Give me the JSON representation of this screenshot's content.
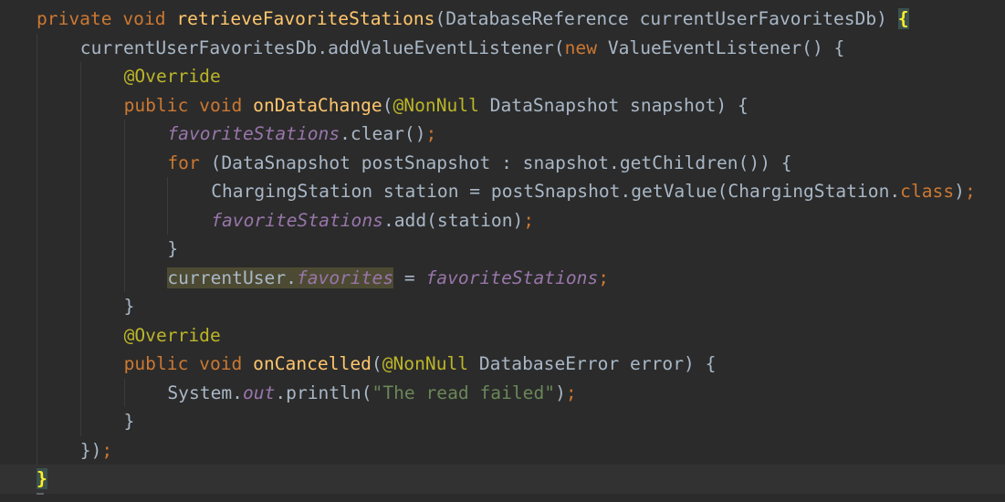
{
  "editor": {
    "language": "Java",
    "theme_colors": {
      "background": "#2b2b2b",
      "current_line": "#323232",
      "keyword": "#cc7832",
      "method": "#ffc66d",
      "annotation": "#bbb529",
      "field": "#9876aa",
      "string": "#6a8759",
      "default": "#a9b7c6"
    },
    "lines": [
      {
        "indent": 0,
        "tokens": [
          {
            "t": "private",
            "c": "kw"
          },
          {
            "t": " "
          },
          {
            "t": "void",
            "c": "kw"
          },
          {
            "t": " "
          },
          {
            "t": "retrieveFavoriteStations",
            "c": "fn"
          },
          {
            "t": "(DatabaseReference currentUserFavoritesDb) "
          },
          {
            "t": "{",
            "c": "brace-match"
          }
        ]
      },
      {
        "indent": 1,
        "tokens": [
          {
            "t": "currentUserFavoritesDb.addValueEventListener("
          },
          {
            "t": "new",
            "c": "kw"
          },
          {
            "t": " ValueEventListener() {"
          }
        ]
      },
      {
        "indent": 2,
        "tokens": [
          {
            "t": "@Override",
            "c": "ann"
          }
        ]
      },
      {
        "indent": 2,
        "tokens": [
          {
            "t": "public",
            "c": "kw"
          },
          {
            "t": " "
          },
          {
            "t": "void",
            "c": "kw"
          },
          {
            "t": " "
          },
          {
            "t": "onDataChange",
            "c": "fn"
          },
          {
            "t": "("
          },
          {
            "t": "@NonNull",
            "c": "ann"
          },
          {
            "t": " DataSnapshot snapshot) {"
          }
        ]
      },
      {
        "indent": 3,
        "tokens": [
          {
            "t": "favoriteStations",
            "c": "fld"
          },
          {
            "t": ".clear()"
          },
          {
            "t": ";",
            "c": "pun"
          }
        ]
      },
      {
        "indent": 3,
        "tokens": [
          {
            "t": "for",
            "c": "kw"
          },
          {
            "t": " (DataSnapshot postSnapshot : snapshot.getChildren()) {"
          }
        ]
      },
      {
        "indent": 4,
        "tokens": [
          {
            "t": "ChargingStation station = postSnapshot.getValue(ChargingStation."
          },
          {
            "t": "class",
            "c": "kw"
          },
          {
            "t": ")"
          },
          {
            "t": ";",
            "c": "pun"
          }
        ]
      },
      {
        "indent": 4,
        "tokens": [
          {
            "t": "favoriteStations",
            "c": "fld"
          },
          {
            "t": ".add(station)"
          },
          {
            "t": ";",
            "c": "pun"
          }
        ]
      },
      {
        "indent": 3,
        "tokens": [
          {
            "t": "}"
          }
        ]
      },
      {
        "indent": 3,
        "tokens": [
          {
            "t": "currentUser",
            "c": "sel"
          },
          {
            "t": ".",
            "c": "sel"
          },
          {
            "t": "favorites",
            "c": "fld sel"
          },
          {
            "t": " = "
          },
          {
            "t": "favoriteStations",
            "c": "fld"
          },
          {
            "t": ";",
            "c": "pun"
          }
        ]
      },
      {
        "indent": 2,
        "tokens": [
          {
            "t": "}"
          }
        ]
      },
      {
        "indent": 2,
        "tokens": [
          {
            "t": "@Override",
            "c": "ann"
          }
        ]
      },
      {
        "indent": 2,
        "tokens": [
          {
            "t": "public",
            "c": "kw"
          },
          {
            "t": " "
          },
          {
            "t": "void",
            "c": "kw"
          },
          {
            "t": " "
          },
          {
            "t": "onCancelled",
            "c": "fn"
          },
          {
            "t": "("
          },
          {
            "t": "@NonNull",
            "c": "ann"
          },
          {
            "t": " DatabaseError error) {"
          }
        ]
      },
      {
        "indent": 3,
        "tokens": [
          {
            "t": "System."
          },
          {
            "t": "out",
            "c": "fld"
          },
          {
            "t": ".println("
          },
          {
            "t": "\"The read failed\"",
            "c": "str"
          },
          {
            "t": ")"
          },
          {
            "t": ";",
            "c": "pun"
          }
        ]
      },
      {
        "indent": 2,
        "tokens": [
          {
            "t": "}"
          }
        ]
      },
      {
        "indent": 1,
        "tokens": [
          {
            "t": "})"
          },
          {
            "t": ";",
            "c": "pun"
          }
        ]
      },
      {
        "indent": 0,
        "current": true,
        "tokens": [
          {
            "t": "}",
            "c": "brace-match"
          }
        ]
      }
    ]
  }
}
